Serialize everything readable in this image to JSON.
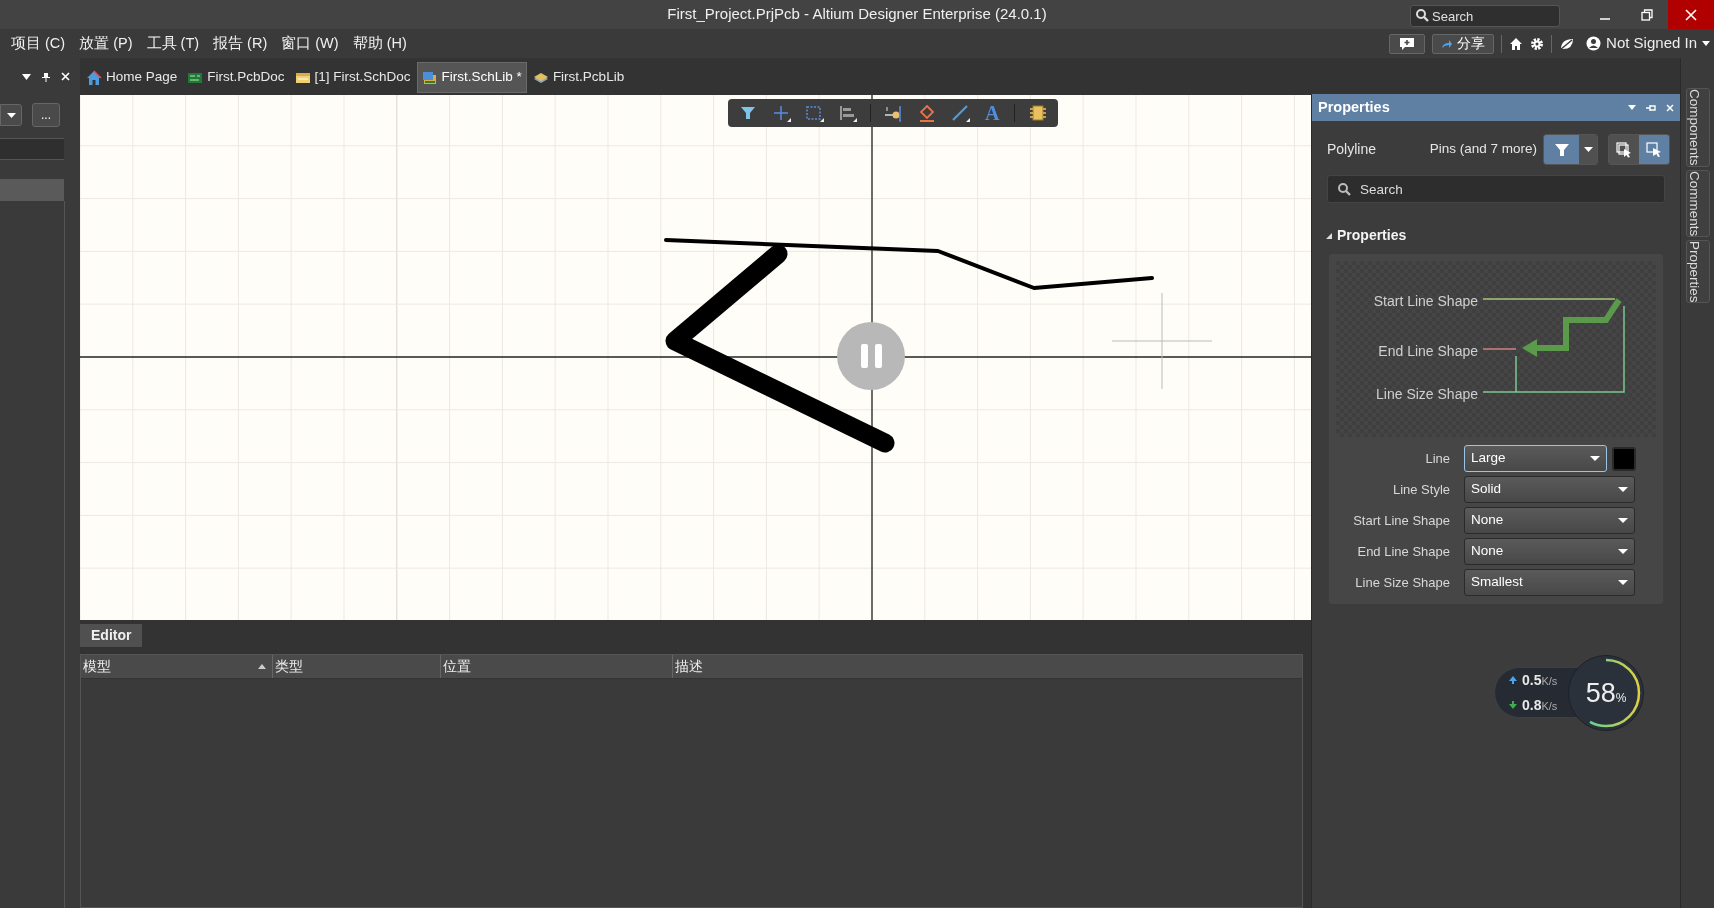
{
  "window": {
    "title": "First_Project.PrjPcb - Altium Designer Enterprise (24.0.1)",
    "search_placeholder": "Search"
  },
  "menu": [
    "项目 (C)",
    "放置 (P)",
    "工具 (T)",
    "报告 (R)",
    "窗口 (W)",
    "帮助 (H)"
  ],
  "header_actions": {
    "share": "分享",
    "user": "Not Signed In"
  },
  "left_panel": {
    "more_button": "..."
  },
  "tabs": [
    {
      "label": "Home Page",
      "kind": "home",
      "selected": false
    },
    {
      "label": "First.PcbDoc",
      "kind": "pcb",
      "selected": false
    },
    {
      "label": "[1] First.SchDoc",
      "kind": "sch",
      "selected": false
    },
    {
      "label": "First.SchLib *",
      "kind": "schlib",
      "selected": true
    },
    {
      "label": "First.PcbLib",
      "kind": "pcblib",
      "selected": false
    }
  ],
  "canvas_toolbar": {
    "text_tool": "A"
  },
  "properties_panel": {
    "title": "Properties",
    "object": "Polyline",
    "filter": "Pins (and 7 more)",
    "search_placeholder": "Search",
    "section": {
      "title": "Properties",
      "expanded": true
    },
    "diagram_labels": [
      "Start Line Shape",
      "End Line Shape",
      "Line Size Shape"
    ],
    "fields": [
      {
        "label": "Line",
        "value": "Large",
        "focused": true,
        "color": "#000000"
      },
      {
        "label": "Line Style",
        "value": "Solid",
        "focused": false
      },
      {
        "label": "Start Line Shape",
        "value": "None",
        "focused": false
      },
      {
        "label": "End Line Shape",
        "value": "None",
        "focused": false
      },
      {
        "label": "Line Size Shape",
        "value": "Smallest",
        "focused": false
      }
    ]
  },
  "side_tabs": [
    "Components",
    "Comments",
    "Properties"
  ],
  "editor": {
    "tab": "Editor",
    "columns": [
      {
        "label": "模型",
        "sorted": true
      },
      {
        "label": "类型",
        "sorted": false
      },
      {
        "label": "位置",
        "sorted": false
      },
      {
        "label": "描述",
        "sorted": false
      }
    ]
  },
  "network_widget": {
    "upload": "0.5",
    "upload_unit": "K/s",
    "download": "0.8",
    "download_unit": "K/s",
    "percent": "58",
    "percent_sign": "%"
  }
}
